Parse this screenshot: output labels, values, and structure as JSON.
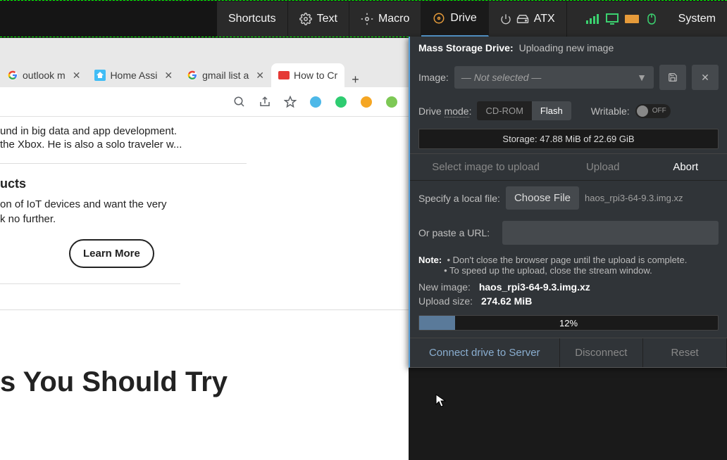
{
  "toolbar": {
    "shortcuts": "Shortcuts",
    "text": "Text",
    "macro": "Macro",
    "drive": "Drive",
    "atx": "ATX",
    "system": "System"
  },
  "tabs": [
    {
      "label": "outlook m",
      "icon": "google"
    },
    {
      "label": "Home Assi",
      "icon": "homeassistant"
    },
    {
      "label": "gmail list a",
      "icon": "google"
    },
    {
      "label": "How to Cr",
      "icon": "redbox",
      "active": true
    }
  ],
  "newtab": "+",
  "content": {
    "line1": "und in big data and app development.",
    "line2": "the Xbox. He is also a solo traveler w...",
    "heading": "ucts",
    "sub1": "on of IoT devices and want the very",
    "sub2": "k no further.",
    "learn": "Learn More",
    "big": "s You Should Try"
  },
  "panel": {
    "title": "Mass Storage Drive:",
    "status": "Uploading new image",
    "image_label": "Image:",
    "image_select_placeholder": "— Not selected —",
    "drive_mode_label": "Drive mode:",
    "mode_cdrom": "CD-ROM",
    "mode_flash": "Flash",
    "writable_label": "Writable:",
    "writable_off": "OFF",
    "storage": "Storage: 47.88 MiB of 22.69 GiB",
    "tab_select": "Select image to upload",
    "tab_upload": "Upload",
    "tab_abort": "Abort",
    "specify_label": "Specify a local file:",
    "choose_file": "Choose File",
    "chosen_file": "haos_rpi3-64-9.3.img.xz",
    "paste_url_label": "Or paste a URL:",
    "note_label": "Note:",
    "note1": "• Don't close the browser page until the upload is complete.",
    "note2": "• To speed up the upload, close the stream window.",
    "new_image_label": "New image:",
    "new_image": "haos_rpi3-64-9.3.img.xz",
    "upload_size_label": "Upload size:",
    "upload_size": "274.62 MiB",
    "progress_pct": 12,
    "progress_label": "12%",
    "connect": "Connect drive to Server",
    "disconnect": "Disconnect",
    "reset": "Reset"
  }
}
